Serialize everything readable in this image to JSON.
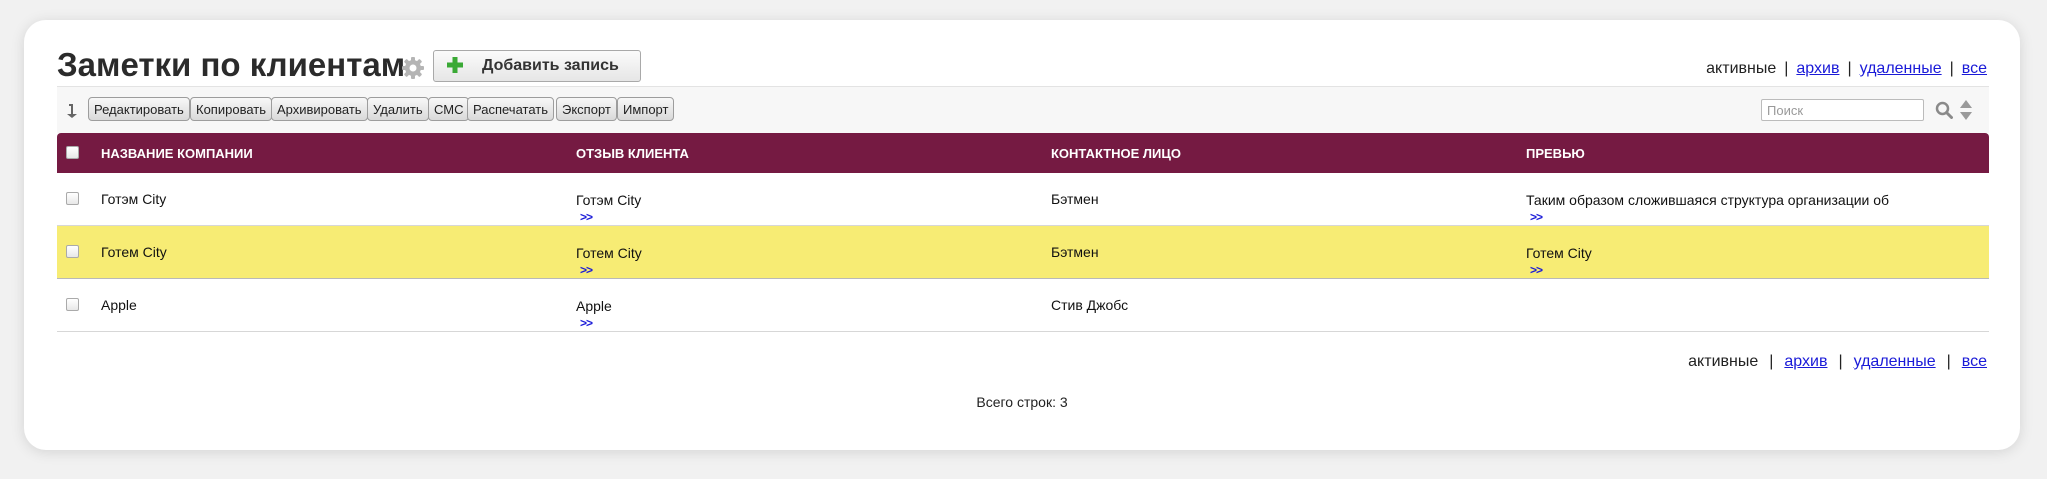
{
  "header": {
    "title": "Заметки по клиентам",
    "add_button_label": "Добавить запись"
  },
  "status_filter": {
    "active_label": "активные",
    "archive_label": "архив",
    "deleted_label": "удаленные",
    "all_label": "все",
    "separator": "|"
  },
  "toolbar": {
    "buttons": [
      "Редактировать",
      "Копировать",
      "Архивировать",
      "Удалить",
      "СМС",
      "Распечатать",
      "Экспорт",
      "Импорт"
    ],
    "search_placeholder": "Поиск"
  },
  "table": {
    "columns": [
      "Название компании",
      "Отзыв клиента",
      "Контактное лицо",
      "Превью"
    ],
    "more_link": ">>",
    "rows": [
      {
        "company": "Готэм City",
        "review": "Готэм City",
        "contact": "Бэтмен",
        "preview": "Таким образом сложившаяся структура организации об",
        "highlighted": false,
        "has_preview_more": true
      },
      {
        "company": "Готем City",
        "review": "Готем City",
        "contact": "Бэтмен",
        "preview": "Готем City",
        "highlighted": true,
        "has_preview_more": true
      },
      {
        "company": "Apple",
        "review": "Apple",
        "contact": "Стив Джобс",
        "preview": "",
        "highlighted": false,
        "has_preview_more": false
      }
    ]
  },
  "footer": {
    "total_rows": "Всего строк: 3"
  },
  "colors": {
    "header_bg": "#751a42",
    "highlight_row": "#f7ec74",
    "link": "#1a1ad8",
    "add_icon": "#3aa935"
  },
  "icons": [
    "gear-icon",
    "plus-icon",
    "sort-icon",
    "search-icon",
    "sort-updown-icon"
  ]
}
